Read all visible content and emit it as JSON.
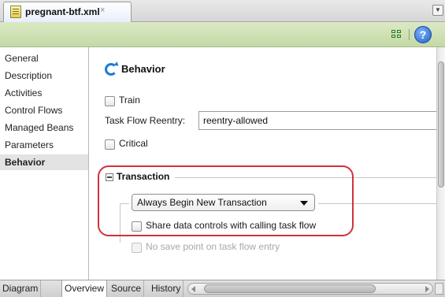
{
  "editor_tab": {
    "title": "pregnant-btf.xml",
    "close_glyph": "×"
  },
  "toolbar": {
    "help_glyph": "?"
  },
  "sidebar": {
    "items": [
      {
        "label": "General"
      },
      {
        "label": "Description"
      },
      {
        "label": "Activities"
      },
      {
        "label": "Control Flows"
      },
      {
        "label": "Managed Beans"
      },
      {
        "label": "Parameters"
      },
      {
        "label": "Behavior",
        "selected": true
      }
    ]
  },
  "behavior": {
    "title": "Behavior",
    "train": {
      "label": "Train",
      "checked": false
    },
    "reentry": {
      "label": "Task Flow Reentry:",
      "value": "reentry-allowed"
    },
    "critical": {
      "label": "Critical",
      "checked": false
    }
  },
  "transaction": {
    "title": "Transaction",
    "selected_option": "Always Begin New Transaction",
    "share_data_controls": {
      "label": "Share data controls with calling task flow",
      "checked": false
    },
    "no_save_point": {
      "label": "No save point on task flow entry",
      "checked": false,
      "enabled": false
    },
    "highlight_color": "#d4303b"
  },
  "bottom_tabs": [
    {
      "label": "Diagram"
    },
    {
      "label": "Overview",
      "active": true
    },
    {
      "label": "Source"
    },
    {
      "label": "History"
    }
  ],
  "colors": {
    "toolbar_green": "#c5d9a7",
    "selected_row": "#e3e3e3",
    "help_blue": "#1f5fc6"
  }
}
